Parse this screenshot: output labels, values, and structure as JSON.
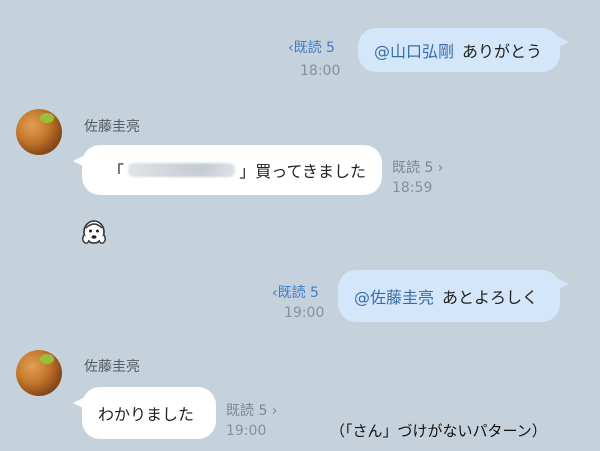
{
  "messages": [
    {
      "read": "‹既読 5",
      "mention": "@山口弘剛",
      "text": "ありがとう",
      "time": "18:00"
    },
    {
      "sender": "佐藤圭亮",
      "text_open": "「",
      "text_close": "」買ってきました",
      "read": "既読 5 ›",
      "time": "18:59"
    },
    {
      "read": "‹既読 5",
      "mention": "@佐藤圭亮",
      "text": "あとよろしく",
      "time": "19:00"
    },
    {
      "sender": "佐藤圭亮",
      "text": "わかりました",
      "read": "既読 5 ›",
      "time": "19:00"
    }
  ],
  "caption": "（「さん」づけがないパターン）",
  "sticker_icon": "monkey-face-icon"
}
